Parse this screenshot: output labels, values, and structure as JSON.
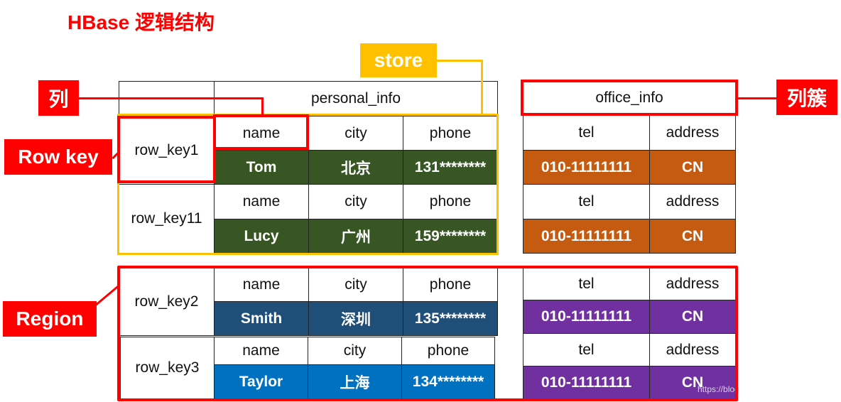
{
  "title": "HBase 逻辑结构",
  "labels": {
    "column": "列",
    "row_key": "Row key",
    "region": "Region",
    "store": "store",
    "column_family": "列簇"
  },
  "families": {
    "personal": "personal_info",
    "office": "office_info"
  },
  "rows": [
    {
      "key": "row_key1",
      "cols": [
        "name",
        "city",
        "phone"
      ],
      "vals": [
        "Tom",
        "北京",
        "131********"
      ],
      "ocols": [
        "tel",
        "address"
      ],
      "ovals": [
        "010-11111111",
        "CN"
      ]
    },
    {
      "key": "row_key11",
      "cols": [
        "name",
        "city",
        "phone"
      ],
      "vals": [
        "Lucy",
        "广州",
        "159********"
      ],
      "ocols": [
        "tel",
        "address"
      ],
      "ovals": [
        "010-11111111",
        "CN"
      ]
    },
    {
      "key": "row_key2",
      "cols": [
        "name",
        "city",
        "phone"
      ],
      "vals": [
        "Smith",
        "深圳",
        "135********"
      ],
      "ocols": [
        "tel",
        "address"
      ],
      "ovals": [
        "010-11111111",
        "CN"
      ]
    },
    {
      "key": "row_key3",
      "cols": [
        "name",
        "city",
        "phone"
      ],
      "vals": [
        "Taylor",
        "上海",
        "134********"
      ],
      "ocols": [
        "tel",
        "address"
      ],
      "ovals": [
        "010-11111111",
        "CN"
      ]
    }
  ],
  "colors": {
    "accent_red": "#ff0000",
    "store_yellow": "#ffc000",
    "row1_personal": "#375623",
    "row2_personal": "#1f4e79",
    "row3_personal": "#0070c0",
    "row1_office": "#c55a11",
    "row2_office": "#7030a0"
  },
  "watermark": "https://blog"
}
